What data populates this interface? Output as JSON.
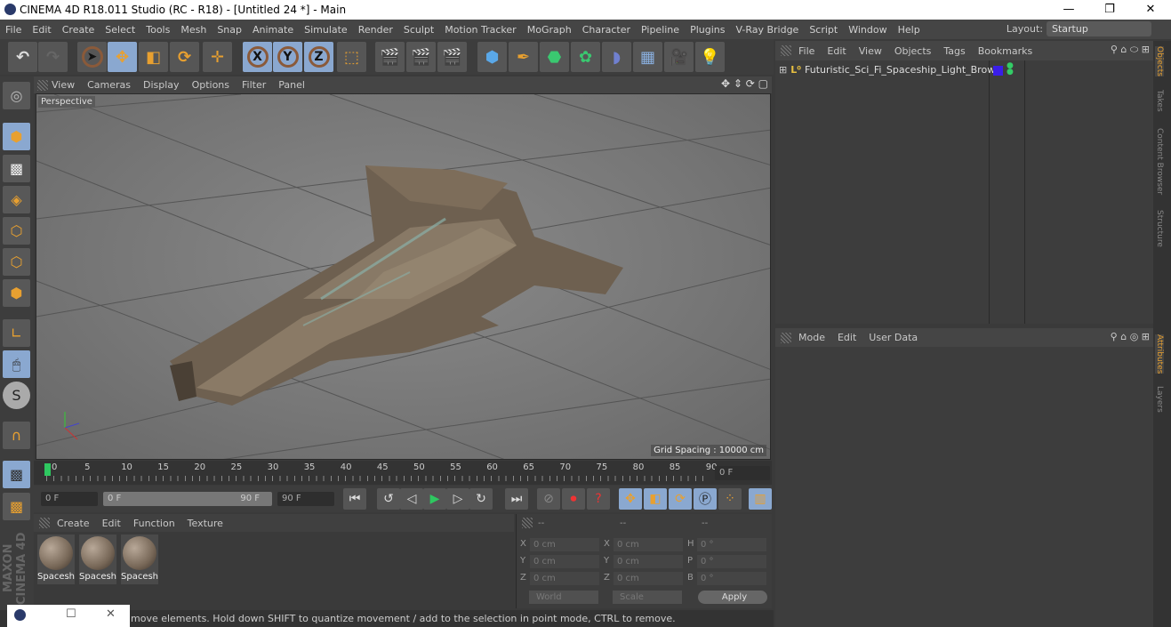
{
  "window": {
    "title": "CINEMA 4D R18.011 Studio (RC - R18) - [Untitled 24 *] - Main"
  },
  "menu": [
    "File",
    "Edit",
    "Create",
    "Select",
    "Tools",
    "Mesh",
    "Snap",
    "Animate",
    "Simulate",
    "Render",
    "Sculpt",
    "Motion Tracker",
    "MoGraph",
    "Character",
    "Pipeline",
    "Plugins",
    "V-Ray Bridge",
    "Script",
    "Window",
    "Help"
  ],
  "layout": {
    "label": "Layout:",
    "value": "Startup"
  },
  "toolbar": {
    "x": "X",
    "y": "Y",
    "z": "Z"
  },
  "viewport": {
    "menu": [
      "View",
      "Cameras",
      "Display",
      "Options",
      "Filter",
      "Panel"
    ],
    "label": "Perspective",
    "grid_spacing": "Grid Spacing : 10000 cm"
  },
  "timeline": {
    "ticks": [
      "0",
      "5",
      "10",
      "15",
      "20",
      "25",
      "30",
      "35",
      "40",
      "45",
      "50",
      "55",
      "60",
      "65",
      "70",
      "75",
      "80",
      "85",
      "90"
    ],
    "current": "0 F",
    "start": "0 F",
    "range_start": "0 F",
    "range_end": "90 F",
    "end": "90 F"
  },
  "materials": {
    "menu": [
      "Create",
      "Edit",
      "Function",
      "Texture"
    ],
    "items": [
      "Spacesh",
      "Spacesh",
      "Spacesh"
    ]
  },
  "coords": {
    "headers": [
      "--",
      "--",
      "--"
    ],
    "rows": [
      {
        "a": "X",
        "av": "0 cm",
        "b": "X",
        "bv": "0 cm",
        "c": "H",
        "cv": "0 °"
      },
      {
        "a": "Y",
        "av": "0 cm",
        "b": "Y",
        "bv": "0 cm",
        "c": "P",
        "cv": "0 °"
      },
      {
        "a": "Z",
        "av": "0 cm",
        "b": "Z",
        "bv": "0 cm",
        "c": "B",
        "cv": "0 °"
      }
    ],
    "mode": "World",
    "type": "Scale",
    "apply": "Apply"
  },
  "status": "move elements. Hold down SHIFT to quantize movement / add to the selection in point mode, CTRL to remove.",
  "branding": "MAXON CINEMA 4D",
  "objects": {
    "menu": [
      "File",
      "Edit",
      "View",
      "Objects",
      "Tags",
      "Bookmarks"
    ],
    "items": [
      {
        "name": "Futuristic_Sci_Fi_Spaceship_Light_Brown",
        "color": "#3a1ee8"
      }
    ]
  },
  "attributes": {
    "menu": [
      "Mode",
      "Edit",
      "User Data"
    ]
  },
  "right_tabs": [
    "Objects",
    "Takes",
    "Content Browser",
    "Structure",
    "Attributes",
    "Layers"
  ],
  "colors": {
    "accent": "#8aa8d0",
    "tab_active": "#e8a030"
  }
}
